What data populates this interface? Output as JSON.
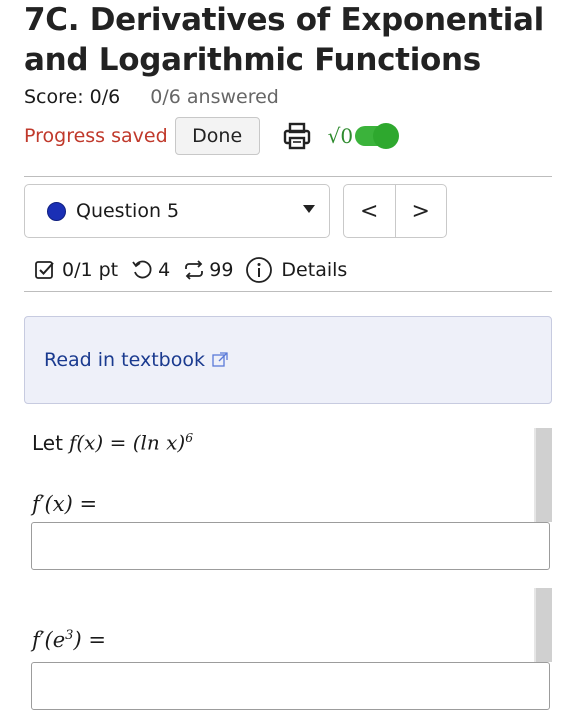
{
  "assignment": {
    "title": "7C. Derivatives of Exponential and Logarithmic Functions",
    "score": "Score: 0/6",
    "answered": "0/6 answered",
    "progress_saved": "Progress saved",
    "done_label": "Done",
    "math_toggle_label": "√0",
    "math_toggle_on": true
  },
  "question_nav": {
    "selected": "Question 5",
    "prev_label": "<",
    "next_label": ">"
  },
  "question_meta": {
    "points": "0/1 pt",
    "attempts": "4",
    "retries": "99",
    "details_label": "Details"
  },
  "resources": {
    "read_in_textbook": "Read in textbook"
  },
  "problem": {
    "let_word": "Let",
    "function_lhs": "f(x) = (ln x)",
    "function_exponent": "6",
    "prompt1": "f′(x) =",
    "prompt2_base": "f′(e",
    "prompt2_exp": "3",
    "prompt2_end": ") ="
  },
  "icons": {
    "printer": "printer-icon",
    "checkbox": "checkbox-icon",
    "retry": "retry-icon",
    "repeat": "repeat-icon",
    "info": "info-icon",
    "external": "external-link-icon"
  },
  "colors": {
    "progress_saved": "#c0392b",
    "toggle": "#3bb33b",
    "question_dot": "#1a2fb5",
    "textbook_link": "#1a3a8f",
    "textbook_bg": "#eef0f9"
  }
}
